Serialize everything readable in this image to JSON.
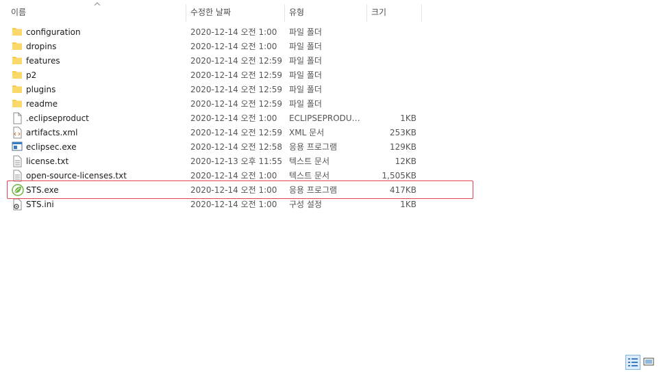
{
  "columns": {
    "name": "이름",
    "date": "수정한 날짜",
    "type": "유형",
    "size": "크기"
  },
  "files": [
    {
      "icon": "folder-icon",
      "name": "configuration",
      "date": "2020-12-14 오전 1:00",
      "type": "파일 폴더",
      "size": ""
    },
    {
      "icon": "folder-icon",
      "name": "dropins",
      "date": "2020-12-14 오전 1:00",
      "type": "파일 폴더",
      "size": ""
    },
    {
      "icon": "folder-icon",
      "name": "features",
      "date": "2020-12-14 오전 12:59",
      "type": "파일 폴더",
      "size": ""
    },
    {
      "icon": "folder-icon",
      "name": "p2",
      "date": "2020-12-14 오전 12:59",
      "type": "파일 폴더",
      "size": ""
    },
    {
      "icon": "folder-icon",
      "name": "plugins",
      "date": "2020-12-14 오전 12:59",
      "type": "파일 폴더",
      "size": ""
    },
    {
      "icon": "folder-icon",
      "name": "readme",
      "date": "2020-12-14 오전 12:59",
      "type": "파일 폴더",
      "size": ""
    },
    {
      "icon": "blank-file-icon",
      "name": ".eclipseproduct",
      "date": "2020-12-14 오전 1:00",
      "type": "ECLIPSEPRODUCT...",
      "size": "1KB"
    },
    {
      "icon": "xml-file-icon",
      "name": "artifacts.xml",
      "date": "2020-12-14 오전 12:59",
      "type": "XML 문서",
      "size": "253KB"
    },
    {
      "icon": "exe-window-icon",
      "name": "eclipsec.exe",
      "date": "2020-12-14 오전 12:58",
      "type": "응용 프로그램",
      "size": "129KB"
    },
    {
      "icon": "text-file-icon",
      "name": "license.txt",
      "date": "2020-12-13 오후 11:55",
      "type": "텍스트 문서",
      "size": "12KB"
    },
    {
      "icon": "text-file-icon",
      "name": "open-source-licenses.txt",
      "date": "2020-12-14 오전 1:00",
      "type": "텍스트 문서",
      "size": "1,505KB"
    },
    {
      "icon": "spring-leaf-icon",
      "name": "STS.exe",
      "date": "2020-12-14 오전 1:00",
      "type": "응용 프로그램",
      "size": "417KB"
    },
    {
      "icon": "settings-file-icon",
      "name": "STS.ini",
      "date": "2020-12-14 오전 1:00",
      "type": "구성 설정",
      "size": "1KB"
    }
  ],
  "colors": {
    "highlight": "#e0424e",
    "folder": "#f7c948",
    "selected_view": "#dcecfc"
  }
}
